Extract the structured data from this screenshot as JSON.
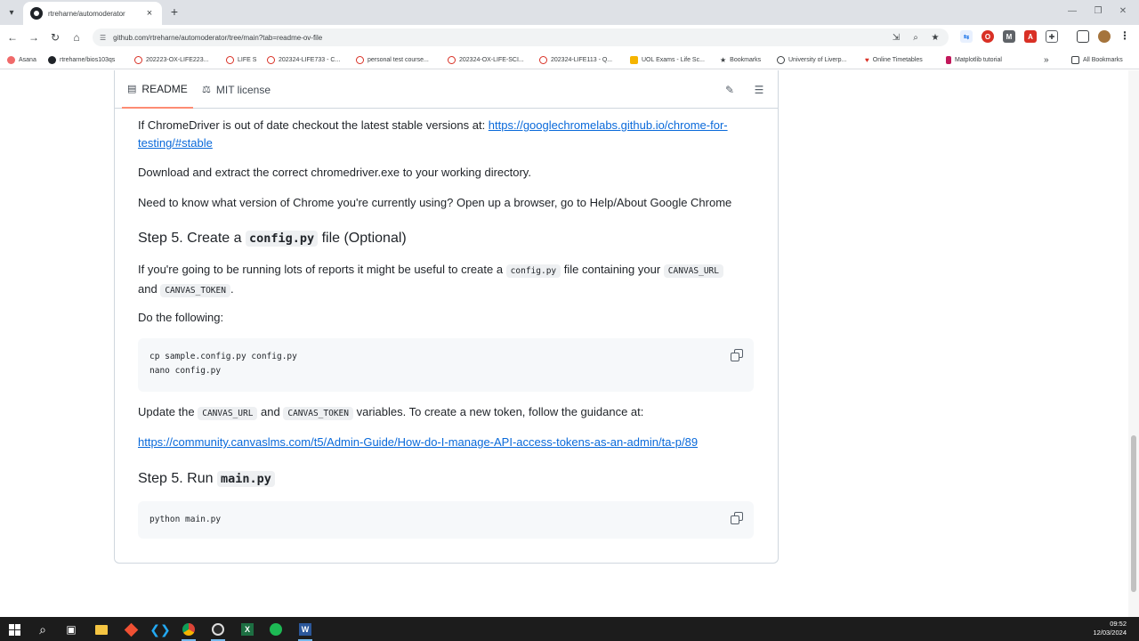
{
  "browser": {
    "tab_title": "rtreharne/automoderator",
    "tab_close": "×",
    "new_tab": "+",
    "url": "github.com/rtreharne/automoderator/tree/main?tab=readme-ov-file",
    "bookmarks": [
      {
        "label": "Asana",
        "icon": "asana-icon",
        "color": "#f06a6a"
      },
      {
        "label": "rtreharne/bios103qs",
        "icon": "github-icon",
        "color": "#1f2328"
      },
      {
        "label": "202223-OX-LIFE223...",
        "icon": "canvas-icon",
        "color": "#d93025"
      },
      {
        "label": "LIFE S",
        "icon": "canvas-icon",
        "color": "#d93025"
      },
      {
        "label": "202324-LIFE733 - C...",
        "icon": "canvas-icon",
        "color": "#d93025"
      },
      {
        "label": "personal test course...",
        "icon": "canvas-icon",
        "color": "#d93025"
      },
      {
        "label": "202324-OX-LIFE-SCI...",
        "icon": "canvas-icon",
        "color": "#d93025"
      },
      {
        "label": "202324-LIFE113 - Q...",
        "icon": "canvas-icon",
        "color": "#d93025"
      },
      {
        "label": "UOL Exams - Life Sc...",
        "icon": "uol-icon",
        "color": "#f5b400"
      },
      {
        "label": "Bookmarks",
        "icon": "star-icon",
        "color": "#3c4043"
      },
      {
        "label": "University of Liverp...",
        "icon": "globe-icon",
        "color": "#3c4043"
      },
      {
        "label": "Online Timetables",
        "icon": "heart-icon",
        "color": "#d93025"
      },
      {
        "label": "Matplotlib tutorial",
        "icon": "matplotlib-icon",
        "color": "#c2185b"
      }
    ],
    "bookmarks_overflow": "»",
    "all_bookmarks": "All Bookmarks"
  },
  "readme": {
    "tab_readme": "README",
    "tab_license": "MIT license",
    "p1_text": "If ChromeDriver is out of date checkout the latest stable versions at: ",
    "p1_link_a": "https://googlechromelabs.github.io/chrome-for-",
    "p1_link_b": "testing/#stable",
    "p2": "Download and extract the correct chromedriver.exe to your working directory.",
    "p3": "Need to know what version of Chrome you're currently using? Open up a browser, go to Help/About Google Chrome",
    "h_step5a_pre": "Step 5. Create a ",
    "h_step5a_code": "config.py",
    "h_step5a_post": " file (Optional)",
    "p4_a": "If you're going to be running lots of reports it might be useful to create a ",
    "p4_code1": "config.py",
    "p4_b": " file containing your ",
    "p4_code2": "CANVAS_URL",
    "p4_c": "and ",
    "p4_code3": "CANVAS_TOKEN",
    "p4_d": ".",
    "p5": "Do the following:",
    "code1_line1": "cp sample.config.py config.py",
    "code1_line2": "nano config.py",
    "p6_a": "Update the ",
    "p6_code1": "CANVAS_URL",
    "p6_b": " and ",
    "p6_code2": "CANVAS_TOKEN",
    "p6_c": " variables. To create a new token, follow the guidance at:",
    "p7_link": "https://community.canvaslms.com/t5/Admin-Guide/How-do-I-manage-API-access-tokens-as-an-admin/ta-p/89",
    "h_step5b_pre": "Step 5. Run ",
    "h_step5b_code": "main.py",
    "code2_line1": "python main.py"
  },
  "taskbar": {
    "time": "09:52",
    "date": "12/03/2024"
  }
}
